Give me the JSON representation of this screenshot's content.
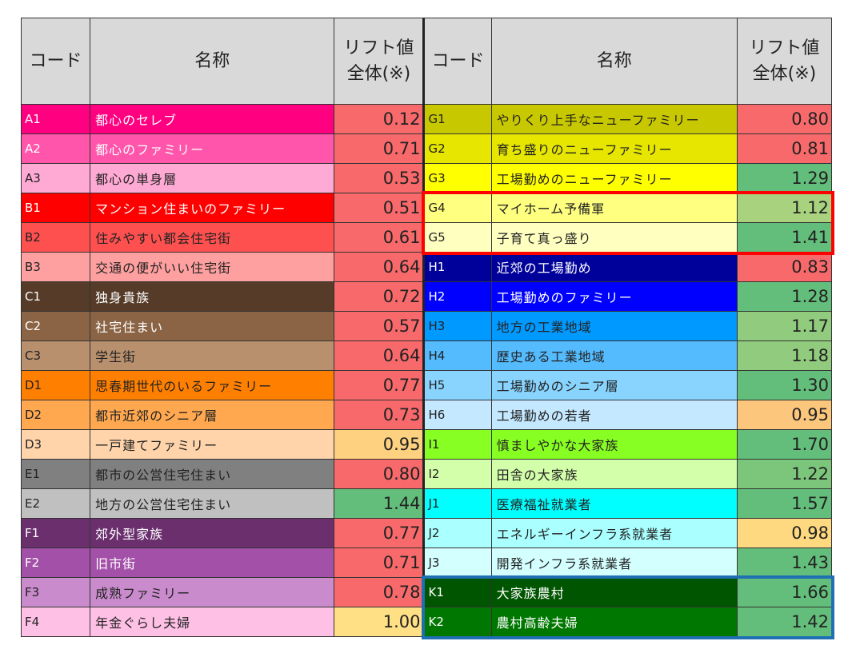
{
  "header": {
    "code": "コード",
    "name": "名称",
    "lift_line1": "リフト値",
    "lift_line2": "全体(※)"
  },
  "rows": [
    {
      "left": {
        "code": "A1",
        "name": "都心のセレブ",
        "value": "0.12",
        "bg": "#ff0080",
        "vbg": "#f8696b",
        "light": true
      },
      "right": {
        "code": "G1",
        "name": "やりくり上手なニューファミリー",
        "value": "0.80",
        "bg": "#c8c800",
        "vbg": "#f8696b",
        "light": false
      }
    },
    {
      "left": {
        "code": "A2",
        "name": "都心のファミリー",
        "value": "0.71",
        "bg": "#ff55aa",
        "vbg": "#f8696b",
        "light": true
      },
      "right": {
        "code": "G2",
        "name": "育ち盛りのニューファミリー",
        "value": "0.81",
        "bg": "#e6e600",
        "vbg": "#f8696b",
        "light": false
      }
    },
    {
      "left": {
        "code": "A3",
        "name": "都心の単身層",
        "value": "0.53",
        "bg": "#ffaad4",
        "vbg": "#f8696b",
        "light": false
      },
      "right": {
        "code": "G3",
        "name": "工場勤めのニューファミリー",
        "value": "1.29",
        "bg": "#ffff00",
        "vbg": "#63be7b",
        "light": false
      }
    },
    {
      "left": {
        "code": "B1",
        "name": "マンション住まいのファミリー",
        "value": "0.51",
        "bg": "#ff0000",
        "vbg": "#f8696b",
        "light": true
      },
      "right": {
        "code": "G4",
        "name": "マイホーム予備軍",
        "value": "1.12",
        "bg": "#ffff80",
        "vbg": "#a9d27f",
        "light": false
      }
    },
    {
      "left": {
        "code": "B2",
        "name": "住みやすい都会住宅街",
        "value": "0.61",
        "bg": "#ff5050",
        "vbg": "#f8696b",
        "light": false
      },
      "right": {
        "code": "G5",
        "name": "子育て真っ盛り",
        "value": "1.41",
        "bg": "#ffffc0",
        "vbg": "#63be7b",
        "light": false
      }
    },
    {
      "left": {
        "code": "B3",
        "name": "交通の便がいい住宅街",
        "value": "0.64",
        "bg": "#ffa0a0",
        "vbg": "#f8696b",
        "light": false
      },
      "right": {
        "code": "H1",
        "name": "近郊の工場勤め",
        "value": "0.83",
        "bg": "#00009a",
        "vbg": "#f8696b",
        "light": true
      }
    },
    {
      "left": {
        "code": "C1",
        "name": "独身貴族",
        "value": "0.72",
        "bg": "#553b28",
        "vbg": "#f8696b",
        "light": true
      },
      "right": {
        "code": "H2",
        "name": "工場勤めのファミリー",
        "value": "1.28",
        "bg": "#0000ff",
        "vbg": "#63be7b",
        "light": true
      }
    },
    {
      "left": {
        "code": "C2",
        "name": "社宅住まい",
        "value": "0.57",
        "bg": "#8b6445",
        "vbg": "#f8696b",
        "light": true
      },
      "right": {
        "code": "H3",
        "name": "地方の工業地域",
        "value": "1.17",
        "bg": "#0099ff",
        "vbg": "#91cb7d",
        "light": false
      }
    },
    {
      "left": {
        "code": "C3",
        "name": "学生街",
        "value": "0.64",
        "bg": "#b9906e",
        "vbg": "#f8696b",
        "light": false
      },
      "right": {
        "code": "H4",
        "name": "歴史ある工業地域",
        "value": "1.18",
        "bg": "#55bbff",
        "vbg": "#91cb7d",
        "light": false
      }
    },
    {
      "left": {
        "code": "D1",
        "name": "思春期世代のいるファミリー",
        "value": "0.77",
        "bg": "#ff7f00",
        "vbg": "#f8696b",
        "light": false
      },
      "right": {
        "code": "H5",
        "name": "工場勤めのシニア層",
        "value": "1.30",
        "bg": "#88d4ff",
        "vbg": "#63be7b",
        "light": false
      }
    },
    {
      "left": {
        "code": "D2",
        "name": "都市近郊のシニア層",
        "value": "0.73",
        "bg": "#ffa850",
        "vbg": "#f8696b",
        "light": false
      },
      "right": {
        "code": "H6",
        "name": "工場勤めの若者",
        "value": "0.95",
        "bg": "#c4e8ff",
        "vbg": "#fcc77c",
        "light": false
      }
    },
    {
      "left": {
        "code": "D3",
        "name": "一戸建てファミリー",
        "value": "0.95",
        "bg": "#ffd4aa",
        "vbg": "#fdd17f",
        "light": false
      },
      "right": {
        "code": "I1",
        "name": "慎ましやかな大家族",
        "value": "1.70",
        "bg": "#88ff22",
        "vbg": "#63be7b",
        "light": false
      }
    },
    {
      "left": {
        "code": "E1",
        "name": "都市の公営住宅住まい",
        "value": "0.80",
        "bg": "#808080",
        "vbg": "#f8696b",
        "light": false
      },
      "right": {
        "code": "I2",
        "name": "田舎の大家族",
        "value": "1.22",
        "bg": "#d4ffaa",
        "vbg": "#7cc67c",
        "light": false
      }
    },
    {
      "left": {
        "code": "E2",
        "name": "地方の公営住宅住まい",
        "value": "1.44",
        "bg": "#c0c0c0",
        "vbg": "#63be7b",
        "light": false
      },
      "right": {
        "code": "J1",
        "name": "医療福祉就業者",
        "value": "1.57",
        "bg": "#00ffff",
        "vbg": "#63be7b",
        "light": false
      }
    },
    {
      "left": {
        "code": "F1",
        "name": "郊外型家族",
        "value": "0.77",
        "bg": "#6b2f6e",
        "vbg": "#f8696b",
        "light": true
      },
      "right": {
        "code": "J2",
        "name": "エネルギーインフラ系就業者",
        "value": "0.98",
        "bg": "#aaffff",
        "vbg": "#ffd97f",
        "light": false
      }
    },
    {
      "left": {
        "code": "F2",
        "name": "旧市街",
        "value": "0.71",
        "bg": "#a350a8",
        "vbg": "#f8696b",
        "light": true
      },
      "right": {
        "code": "J3",
        "name": "開発インフラ系就業者",
        "value": "1.43",
        "bg": "#d4ffff",
        "vbg": "#63be7b",
        "light": false
      }
    },
    {
      "left": {
        "code": "F3",
        "name": "成熟ファミリー",
        "value": "0.78",
        "bg": "#c98bcc",
        "vbg": "#f8696b",
        "light": false
      },
      "right": {
        "code": "K1",
        "name": "大家族農村",
        "value": "1.66",
        "bg": "#005500",
        "vbg": "#63be7b",
        "light": true
      }
    },
    {
      "left": {
        "code": "F4",
        "name": "年金ぐらし夫婦",
        "value": "1.00",
        "bg": "#ffc0e6",
        "vbg": "#ffe084",
        "light": false
      },
      "right": {
        "code": "K2",
        "name": "農村高齢夫婦",
        "value": "1.42",
        "bg": "#007700",
        "vbg": "#63be7b",
        "light": true
      }
    }
  ],
  "highlights": [
    {
      "name": "red-highlight",
      "color": "#ff0000"
    },
    {
      "name": "blue-highlight",
      "color": "#1f6fb3"
    }
  ]
}
